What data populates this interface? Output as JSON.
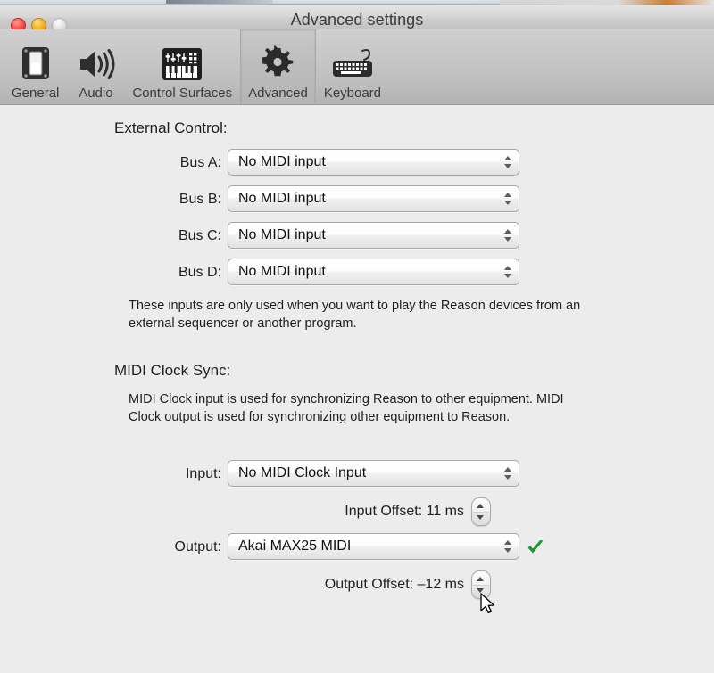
{
  "window": {
    "title": "Advanced settings",
    "traffic_lights": [
      "close",
      "minimize",
      "zoom"
    ]
  },
  "toolbar": {
    "tabs": [
      {
        "label": "General",
        "icon": "general-icon",
        "selected": false
      },
      {
        "label": "Audio",
        "icon": "speaker-icon",
        "selected": false
      },
      {
        "label": "Control Surfaces",
        "icon": "midi-keyboard-icon",
        "selected": false
      },
      {
        "label": "Advanced",
        "icon": "gear-icon",
        "selected": true
      },
      {
        "label": "Keyboard",
        "icon": "computer-keyboard-icon",
        "selected": false
      }
    ]
  },
  "external_control": {
    "title": "External Control:",
    "rows": [
      {
        "label": "Bus A:",
        "value": "No MIDI input"
      },
      {
        "label": "Bus B:",
        "value": "No MIDI input"
      },
      {
        "label": "Bus C:",
        "value": "No MIDI input"
      },
      {
        "label": "Bus D:",
        "value": "No MIDI input"
      }
    ],
    "help": "These inputs are only used when you want to play the Reason devices from an external sequencer or another program."
  },
  "midi_clock_sync": {
    "title": "MIDI Clock Sync:",
    "help": "MIDI Clock input is used for synchronizing Reason to other equipment. MIDI Clock output is used for synchronizing other equipment to Reason.",
    "input": {
      "label": "Input:",
      "value": "No MIDI Clock Input",
      "offset_label": "Input Offset: 11 ms"
    },
    "output": {
      "label": "Output:",
      "value": "Akai MAX25 MIDI",
      "offset_label": "Output Offset: –12 ms",
      "status_icon": "green-check-icon"
    }
  },
  "colors": {
    "window_background": "#ececec",
    "toolbar_background": "#c4c4c4",
    "check_green": "#1a9a2e",
    "text": "#1f1f1f"
  }
}
